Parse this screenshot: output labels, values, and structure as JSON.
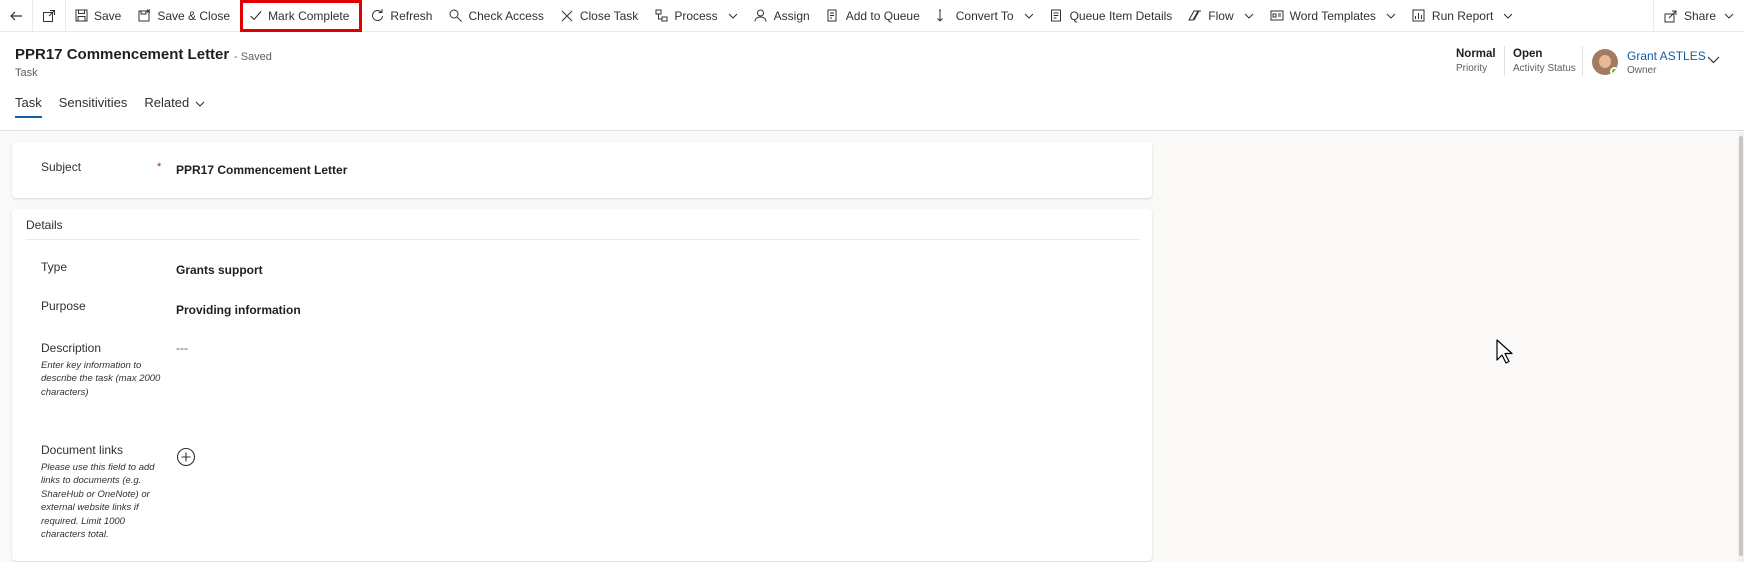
{
  "commandbar": {
    "items": [
      {
        "label": "Save",
        "icon": "save-icon"
      },
      {
        "label": "Save & Close",
        "icon": "save-close-icon"
      },
      {
        "label": "Mark Complete",
        "icon": "checkmark-icon",
        "highlighted": true
      },
      {
        "label": "Refresh",
        "icon": "refresh-icon"
      },
      {
        "label": "Check Access",
        "icon": "search-icon"
      },
      {
        "label": "Close Task",
        "icon": "close-icon"
      },
      {
        "label": "Process",
        "icon": "process-icon",
        "dropdown": true
      },
      {
        "label": "Assign",
        "icon": "person-icon"
      },
      {
        "label": "Add to Queue",
        "icon": "queue-icon"
      },
      {
        "label": "Convert To",
        "icon": "convert-icon",
        "dropdown": true
      },
      {
        "label": "Queue Item Details",
        "icon": "details-icon"
      },
      {
        "label": "Flow",
        "icon": "flow-icon",
        "dropdown": true
      },
      {
        "label": "Word Templates",
        "icon": "word-icon",
        "dropdown": true
      },
      {
        "label": "Run Report",
        "icon": "report-icon",
        "dropdown": true
      }
    ],
    "share_label": "Share",
    "highlight_color": "#e00000"
  },
  "header": {
    "title": "PPR17 Commencement Letter",
    "saved_status": "- Saved",
    "entity": "Task",
    "priority_value": "Normal",
    "priority_label": "Priority",
    "status_value": "Open",
    "status_label": "Activity Status",
    "owner_name": "Grant ASTLES",
    "owner_label": "Owner"
  },
  "tabs": [
    {
      "label": "Task",
      "active": true
    },
    {
      "label": "Sensitivities"
    },
    {
      "label": "Related",
      "dropdown": true
    }
  ],
  "form": {
    "subject_label": "Subject",
    "subject_value": "PPR17 Commencement Letter",
    "required_mark": "*",
    "details_title": "Details",
    "type_label": "Type",
    "type_value": "Grants support",
    "purpose_label": "Purpose",
    "purpose_value": "Providing information",
    "description_label": "Description",
    "description_value": "---",
    "description_help": "Enter key information to describe the task (max 2000 characters)",
    "doclinks_label": "Document links",
    "doclinks_help": "Please use this field to add links to documents (e.g. ShareHub or OneNote) or external website links if required. Limit 1000 characters total."
  },
  "colors": {
    "accent": "#115ea3",
    "required": "#a4262c",
    "presence": "#6bb700"
  }
}
